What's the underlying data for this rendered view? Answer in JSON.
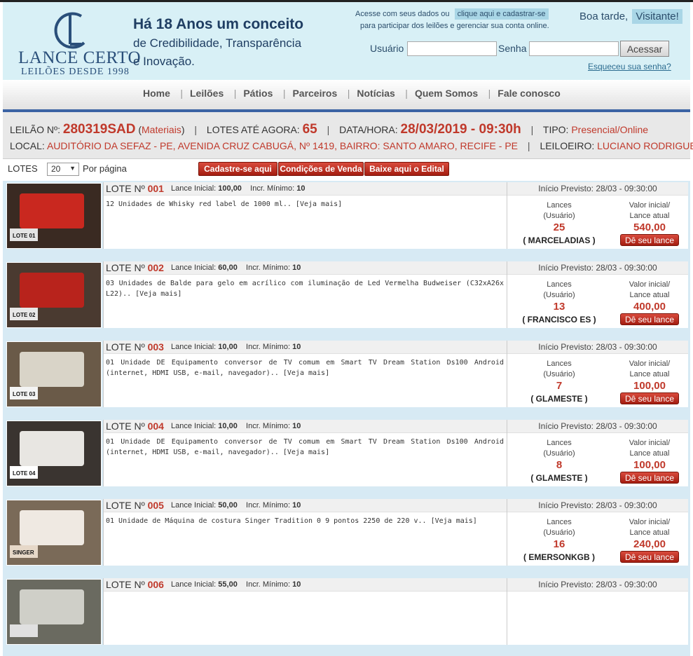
{
  "header": {
    "logo_name": "LANCE CERTO",
    "logo_sub": "LEILÕES DESDE 1998",
    "slogan_line1": "Há 18 Anos um conceito",
    "slogan_line2": "de Credibilidade, Transparência",
    "slogan_line3": "e Inovação.",
    "access_text1": "Acesse com seus dados ou",
    "access_link": "clique aqui e cadastrar-se",
    "access_text2": "para participar dos leilões e gerenciar sua conta online.",
    "greeting": "Boa tarde,",
    "visitor": "Visitante!",
    "user_label": "Usuário",
    "user_value": "",
    "pass_label": "Senha",
    "pass_value": "",
    "login_button": "Acessar",
    "forgot_link": "Esqueceu sua senha?"
  },
  "nav": {
    "items": [
      "Home",
      "Leilões",
      "Pátios",
      "Parceiros",
      "Notícias",
      "Quem Somos",
      "Fale conosco"
    ]
  },
  "auction": {
    "leilao_label": "LEILÃO Nº:",
    "leilao_number": "280319SAD",
    "leilao_paren_open": "(",
    "leilao_category": "Materiais",
    "leilao_paren_close": ")",
    "lotes_label": "LOTES ATÉ AGORA:",
    "lotes_count": "65",
    "datetime_label": "DATA/HORA:",
    "datetime": "28/03/2019 - 09:30h",
    "tipo_label": "TIPO:",
    "tipo": "Presencial/Online",
    "local_label": "LOCAL:",
    "local": "AUDITÓRIO DA SEFAZ - PE, AVENIDA CRUZ CABUGÁ, Nº 1419, BAIRRO: SANTO AMARO, RECIFE - PE",
    "leiloeiro_label": "LEILOEIRO:",
    "leiloeiro": "LUCIANO RODRIGUES",
    "separator": "|"
  },
  "lotes_bar": {
    "label": "LOTES",
    "per_page_value": "20",
    "per_page_label": "Por página",
    "btn_cadastre": "Cadastre-se aqui",
    "btn_condicoes": "Condições de Venda",
    "btn_edital": "Baixe aqui o Edital"
  },
  "labels": {
    "lote": "LOTE Nº",
    "lance_inicial": "Lance Inicial:",
    "incr_minimo": "Incr. Mínimo:",
    "inicio_previsto": "Início Previsto:",
    "lances": "Lances",
    "usuario": "(Usuário)",
    "valor_inicial": "Valor inicial/",
    "lance_atual": "Lance atual",
    "bid_button": "Dê seu lance"
  },
  "lots": [
    {
      "number": "001",
      "lance_inicial": "100,00",
      "incr_minimo": "10",
      "description": "12 Unidades de Whisky red label de 1000 ml.. [Veja mais]",
      "inicio": "28/03 - 09:30:00",
      "lances": "25",
      "usuario": "( MARCELADIAS )",
      "valor": "540,00",
      "thumb_tag": "LOTE 01"
    },
    {
      "number": "002",
      "lance_inicial": "60,00",
      "incr_minimo": "10",
      "description": "03 Unidades de Balde para gelo em acrílico com iluminação de Led Vermelha Budweiser (C32xA26x L22).. [Veja mais]",
      "inicio": "28/03 - 09:30:00",
      "lances": "13",
      "usuario": "( FRANCISCO ES )",
      "valor": "400,00",
      "thumb_tag": "LOTE 02"
    },
    {
      "number": "003",
      "lance_inicial": "10,00",
      "incr_minimo": "10",
      "description": "01 Unidade DE Equipamento conversor de TV comum em Smart TV Dream Station Ds100 Android (internet, HDMI USB, e-mail, navegador).. [Veja mais]",
      "inicio": "28/03 - 09:30:00",
      "lances": "7",
      "usuario": "( GLAMESTE )",
      "valor": "100,00",
      "thumb_tag": "LOTE 03"
    },
    {
      "number": "004",
      "lance_inicial": "10,00",
      "incr_minimo": "10",
      "description": "01 Unidade DE Equipamento conversor de TV comum em Smart TV Dream Station Ds100 Android (internet, HDMI USB, e-mail, navegador).. [Veja mais]",
      "inicio": "28/03 - 09:30:00",
      "lances": "8",
      "usuario": "( GLAMESTE )",
      "valor": "100,00",
      "thumb_tag": "LOTE 04"
    },
    {
      "number": "005",
      "lance_inicial": "50,00",
      "incr_minimo": "10",
      "description": "01 Unidade de Máquina de costura Singer Tradition 0 9 pontos 2250 de 220 v.. [Veja mais]",
      "inicio": "28/03 - 09:30:00",
      "lances": "16",
      "usuario": "( EMERSONKGB )",
      "valor": "240,00",
      "thumb_tag": "SINGER"
    },
    {
      "number": "006",
      "lance_inicial": "55,00",
      "incr_minimo": "10",
      "description": "",
      "inicio": "28/03 - 09:30:00",
      "lances": "",
      "usuario": "",
      "valor": "",
      "thumb_tag": ""
    }
  ],
  "colors": {
    "accent_red": "#c0392b",
    "header_bg": "#d8f0f6",
    "nav_underline": "#3b63a4",
    "lot_bg": "#d7eaf4"
  }
}
